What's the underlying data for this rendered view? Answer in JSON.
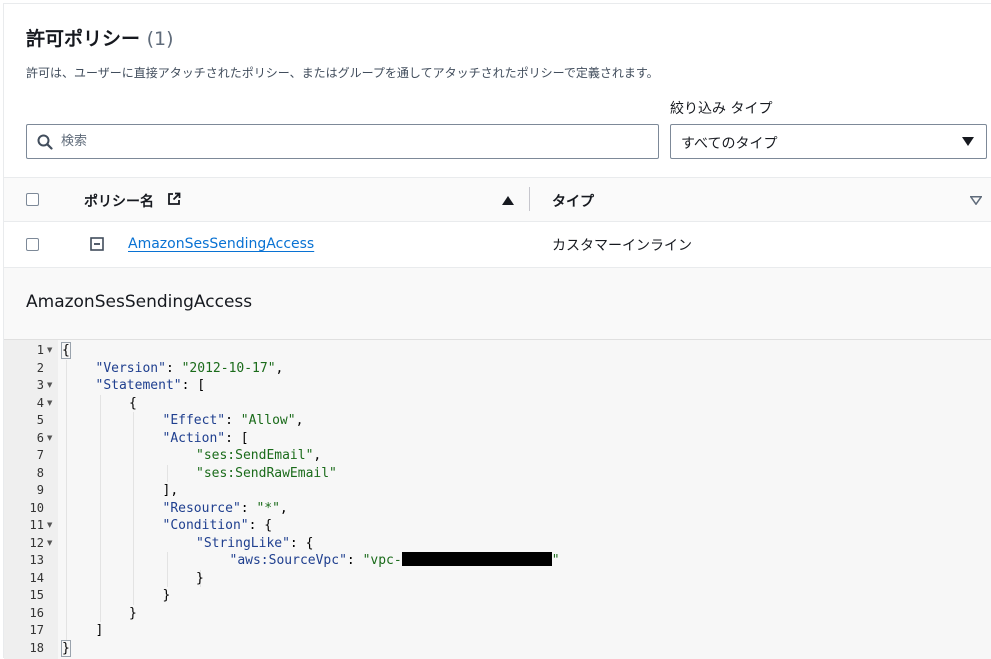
{
  "section": {
    "title": "許可ポリシー",
    "count": "(1)",
    "description": "許可は、ユーザーに直接アタッチされたポリシー、またはグループを通してアタッチされたポリシーで定義されます。"
  },
  "filter": {
    "search_placeholder": "検索",
    "type_label": "絞り込み タイプ",
    "type_value": "すべてのタイプ"
  },
  "table": {
    "headers": {
      "name": "ポリシー名",
      "type": "タイプ"
    },
    "rows": [
      {
        "name": "AmazonSesSendingAccess",
        "type": "カスタマーインライン"
      }
    ]
  },
  "detail": {
    "title": "AmazonSesSendingAccess",
    "lines": [
      {
        "n": "1",
        "fold": true,
        "indent": 0,
        "tokens": [
          [
            "p",
            "{"
          ]
        ]
      },
      {
        "n": "2",
        "fold": false,
        "indent": 1,
        "tokens": [
          [
            "k",
            "\"Version\""
          ],
          [
            "p",
            ": "
          ],
          [
            "s",
            "\"2012-10-17\""
          ],
          [
            "p",
            ","
          ]
        ]
      },
      {
        "n": "3",
        "fold": true,
        "indent": 1,
        "tokens": [
          [
            "k",
            "\"Statement\""
          ],
          [
            "p",
            ": ["
          ]
        ]
      },
      {
        "n": "4",
        "fold": true,
        "indent": 2,
        "tokens": [
          [
            "p",
            "{"
          ]
        ]
      },
      {
        "n": "5",
        "fold": false,
        "indent": 3,
        "tokens": [
          [
            "k",
            "\"Effect\""
          ],
          [
            "p",
            ": "
          ],
          [
            "s",
            "\"Allow\""
          ],
          [
            "p",
            ","
          ]
        ]
      },
      {
        "n": "6",
        "fold": true,
        "indent": 3,
        "tokens": [
          [
            "k",
            "\"Action\""
          ],
          [
            "p",
            ": ["
          ]
        ]
      },
      {
        "n": "7",
        "fold": false,
        "indent": 4,
        "tokens": [
          [
            "s",
            "\"ses:SendEmail\""
          ],
          [
            "p",
            ","
          ]
        ]
      },
      {
        "n": "8",
        "fold": false,
        "indent": 4,
        "tokens": [
          [
            "s",
            "\"ses:SendRawEmail\""
          ]
        ]
      },
      {
        "n": "9",
        "fold": false,
        "indent": 3,
        "tokens": [
          [
            "p",
            "],"
          ]
        ]
      },
      {
        "n": "10",
        "fold": false,
        "indent": 3,
        "tokens": [
          [
            "k",
            "\"Resource\""
          ],
          [
            "p",
            ": "
          ],
          [
            "s",
            "\"*\""
          ],
          [
            "p",
            ","
          ]
        ]
      },
      {
        "n": "11",
        "fold": true,
        "indent": 3,
        "tokens": [
          [
            "k",
            "\"Condition\""
          ],
          [
            "p",
            ": {"
          ]
        ]
      },
      {
        "n": "12",
        "fold": true,
        "indent": 4,
        "tokens": [
          [
            "k",
            "\"StringLike\""
          ],
          [
            "p",
            ": {"
          ]
        ]
      },
      {
        "n": "13",
        "fold": false,
        "indent": 5,
        "tokens": [
          [
            "k",
            "\"aws:SourceVpc\""
          ],
          [
            "p",
            ": "
          ],
          [
            "s",
            "\"vpc-"
          ],
          [
            "redact",
            ""
          ],
          [
            "s",
            "\""
          ]
        ]
      },
      {
        "n": "14",
        "fold": false,
        "indent": 4,
        "tokens": [
          [
            "p",
            "}"
          ]
        ]
      },
      {
        "n": "15",
        "fold": false,
        "indent": 3,
        "tokens": [
          [
            "p",
            "}"
          ]
        ]
      },
      {
        "n": "16",
        "fold": false,
        "indent": 2,
        "tokens": [
          [
            "p",
            "}"
          ]
        ]
      },
      {
        "n": "17",
        "fold": false,
        "indent": 1,
        "tokens": [
          [
            "p",
            "]"
          ]
        ]
      },
      {
        "n": "18",
        "fold": false,
        "indent": 0,
        "tokens": [
          [
            "p",
            "}"
          ]
        ]
      }
    ]
  },
  "colors": {
    "link": "#0972d3",
    "json_key": "#1f3f8f",
    "json_string": "#1a6b1a"
  }
}
